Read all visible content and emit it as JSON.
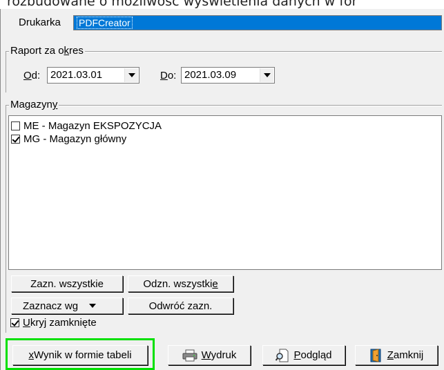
{
  "background_doc_text": "rozbudowane o możliwość wyświetlenia danych w for",
  "printer": {
    "label": "Drukarka",
    "value": "PDFCreator"
  },
  "period": {
    "group_title_pre": "Raport za o",
    "group_title_acc": "k",
    "group_title_post": "res",
    "from_acc": "O",
    "from_rest": "d:",
    "from_value": "2021.03.01",
    "to_acc": "D",
    "to_rest": "o:",
    "to_value": "2021.03.09"
  },
  "warehouses": {
    "group_title_pre": "Magazyn",
    "group_title_acc": "y",
    "items": [
      {
        "label": "ME - Magazyn EKSPOZYCJA",
        "checked": false
      },
      {
        "label": "MG - Magazyn główny",
        "checked": true
      }
    ]
  },
  "buttons": {
    "select_all": "Zazn. wszystkie",
    "deselect_all_pre": "Odzn. wszystki",
    "deselect_all_acc": "e",
    "select_by": "Zaznacz wg",
    "invert": "Odwróć zazn."
  },
  "hide_closed": {
    "acc": "U",
    "rest": "kryj zamknięte",
    "checked": true
  },
  "footer": {
    "table_result_acc": "x",
    "table_result_rest": " Wynik w formie tabeli",
    "print_acc": "W",
    "print_rest": "ydruk",
    "preview_acc": "P",
    "preview_rest": "odgląd",
    "close_acc": "Z",
    "close_rest": "amknij"
  },
  "colors": {
    "selection": "#0078d7",
    "highlight_border": "#00e000",
    "window_bg": "#f0f0f0"
  }
}
